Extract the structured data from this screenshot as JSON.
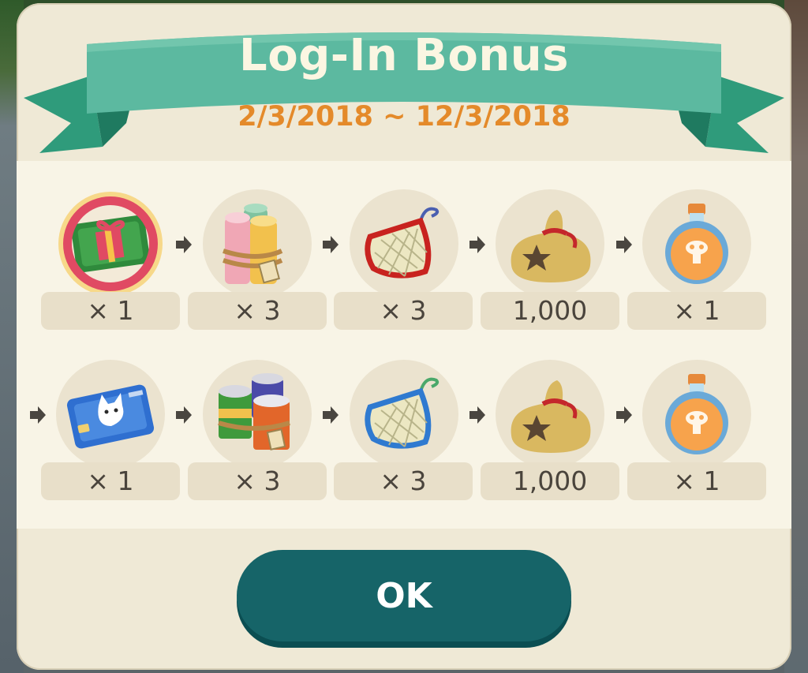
{
  "dialog": {
    "title": "Log-In Bonus",
    "date_range": "2/3/2018 ~ 12/3/2018"
  },
  "rows": [
    {
      "items": [
        {
          "icon": "gift-ticket-icon",
          "qty": "× 1"
        },
        {
          "icon": "fabric-rolls-icon",
          "qty": "× 3"
        },
        {
          "icon": "red-net-icon",
          "qty": "× 3"
        },
        {
          "icon": "bells-bag-icon",
          "qty": "1,000"
        },
        {
          "icon": "essence-bottle-icon",
          "qty": "× 1"
        }
      ]
    },
    {
      "items": [
        {
          "icon": "cat-ticket-card-icon",
          "qty": "× 1"
        },
        {
          "icon": "paint-cans-icon",
          "qty": "× 3"
        },
        {
          "icon": "blue-net-icon",
          "qty": "× 3"
        },
        {
          "icon": "bells-bag-icon",
          "qty": "1,000"
        },
        {
          "icon": "essence-bottle-icon",
          "qty": "× 1"
        }
      ]
    }
  ],
  "ok_label": "OK",
  "colors": {
    "ribbon": "#5cb9a0",
    "date_text": "#e48a2a",
    "button": "#166468",
    "dialog_bg": "#efe9d6"
  }
}
